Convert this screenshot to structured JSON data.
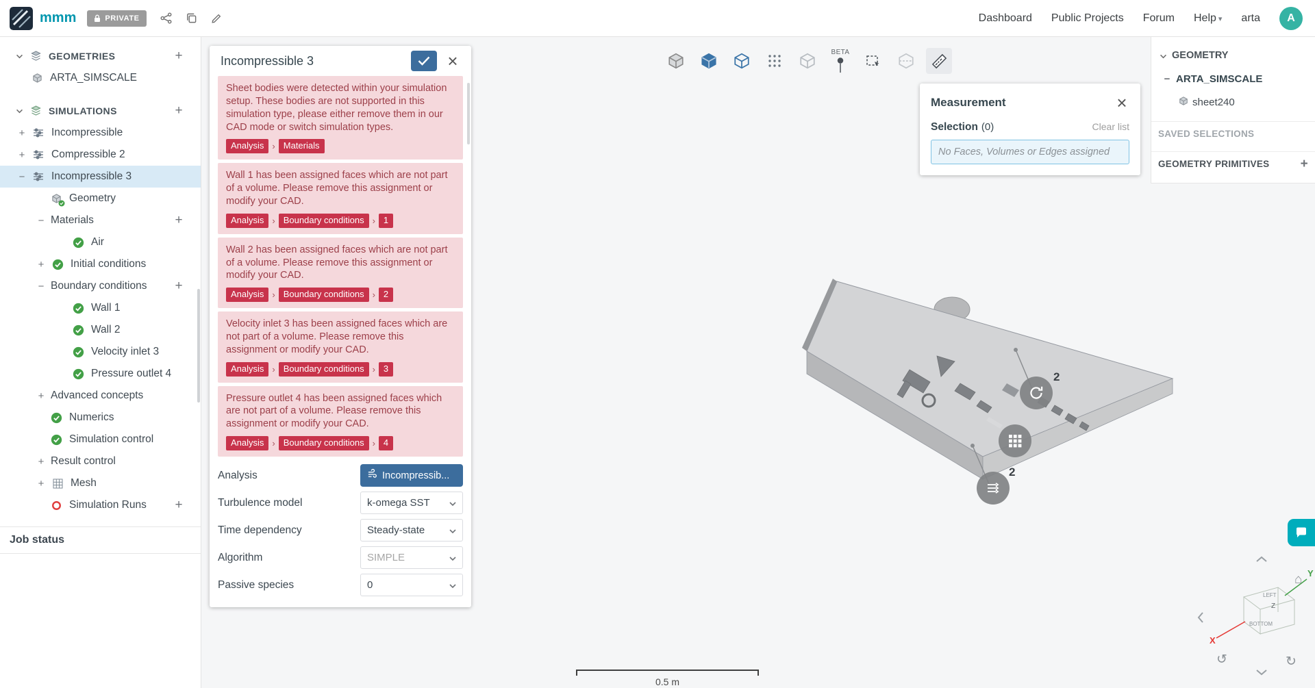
{
  "topbar": {
    "project_name": "mmm",
    "privacy_badge": "PRIVATE",
    "nav_links": [
      "Dashboard",
      "Public Projects",
      "Forum"
    ],
    "help_label": "Help",
    "username": "arta",
    "avatar_initial": "A"
  },
  "toolbar": {
    "beta_label": "BETA"
  },
  "sidebar": {
    "tree": [
      {
        "label": "GEOMETRIES",
        "level": 0,
        "exp": "chev",
        "icon": "stack",
        "add": true,
        "header": true
      },
      {
        "label": "ARTA_SIMSCALE",
        "level": 1,
        "icon": "geom"
      },
      {
        "label": "SIMULATIONS",
        "level": 0,
        "exp": "chev",
        "icon": "sims",
        "add": true,
        "header": true,
        "gap": true
      },
      {
        "label": "Incompressible",
        "level": 1,
        "exp": "plus",
        "icon": "sim"
      },
      {
        "label": "Compressible 2",
        "level": 1,
        "exp": "plus",
        "icon": "sim"
      },
      {
        "label": "Incompressible 3",
        "level": 1,
        "exp": "minus",
        "icon": "sim",
        "selected": true
      },
      {
        "label": "Geometry",
        "level": 2,
        "icon": "geom-check"
      },
      {
        "label": "Materials",
        "level": 2,
        "exp": "minus",
        "add": true
      },
      {
        "label": "Air",
        "level": 3,
        "icon": "check"
      },
      {
        "label": "Initial conditions",
        "level": 2,
        "exp": "plus",
        "icon": "check"
      },
      {
        "label": "Boundary conditions",
        "level": 2,
        "exp": "minus",
        "add": true
      },
      {
        "label": "Wall 1",
        "level": 3,
        "icon": "check"
      },
      {
        "label": "Wall 2",
        "level": 3,
        "icon": "check"
      },
      {
        "label": "Velocity inlet 3",
        "level": 3,
        "icon": "check"
      },
      {
        "label": "Pressure outlet 4",
        "level": 3,
        "icon": "check"
      },
      {
        "label": "Advanced concepts",
        "level": 2,
        "exp": "plus"
      },
      {
        "label": "Numerics",
        "level": 2,
        "icon": "check"
      },
      {
        "label": "Simulation control",
        "level": 2,
        "icon": "check"
      },
      {
        "label": "Result control",
        "level": 2,
        "exp": "plus"
      },
      {
        "label": "Mesh",
        "level": 2,
        "exp": "plus",
        "icon": "mesh"
      },
      {
        "label": "Simulation Runs",
        "level": 2,
        "icon": "record",
        "add": true
      }
    ],
    "job_status_label": "Job status"
  },
  "panel": {
    "title": "Incompressible 3",
    "errors": [
      {
        "text": "Sheet bodies were detected within your simulation setup. These bodies are not supported in this simulation type, please either remove them in our CAD mode or switch simulation types.",
        "badges": [
          "Analysis",
          "Materials"
        ]
      },
      {
        "text": "Wall 1 has been assigned faces which are not part of a volume. Please remove this assignment or modify your CAD.",
        "badges": [
          "Analysis",
          "Boundary conditions",
          "1"
        ]
      },
      {
        "text": "Wall 2 has been assigned faces which are not part of a volume. Please remove this assignment or modify your CAD.",
        "badges": [
          "Analysis",
          "Boundary conditions",
          "2"
        ]
      },
      {
        "text": "Velocity inlet 3 has been assigned faces which are not part of a volume. Please remove this assignment or modify your CAD.",
        "badges": [
          "Analysis",
          "Boundary conditions",
          "3"
        ]
      },
      {
        "text": "Pressure outlet 4 has been assigned faces which are not part of a volume. Please remove this assignment or modify your CAD.",
        "badges": [
          "Analysis",
          "Boundary conditions",
          "4"
        ]
      }
    ],
    "fields": [
      {
        "label": "Analysis",
        "value": "Incompressib...",
        "type": "button"
      },
      {
        "label": "Turbulence model",
        "value": "k-omega SST",
        "type": "select"
      },
      {
        "label": "Time dependency",
        "value": "Steady-state",
        "type": "select"
      },
      {
        "label": "Algorithm",
        "value": "SIMPLE",
        "type": "select-disabled"
      },
      {
        "label": "Passive species",
        "value": "0",
        "type": "select"
      }
    ]
  },
  "measurement": {
    "title": "Measurement",
    "selection_label": "Selection",
    "selection_count": "(0)",
    "clear_label": "Clear list",
    "placeholder": "No Faces, Volumes or Edges assigned"
  },
  "right_panel": {
    "geometry_header": "GEOMETRY",
    "geometry_name": "ARTA_SIMSCALE",
    "sheet_name": "sheet240",
    "saved_selections": "SAVED SELECTIONS",
    "geometry_primitives": "GEOMETRY PRIMITIVES"
  },
  "viewport": {
    "scale_label": "0.5 m",
    "badge_counts": {
      "top": "2",
      "bottom": "2"
    },
    "axes": {
      "x": "X",
      "y": "Y",
      "z": "Z"
    },
    "cube_labels": [
      "LEFT",
      "BOTTOM"
    ]
  },
  "colors": {
    "primary_blue": "#3c6d9d",
    "brand_teal": "#0096ae",
    "error_bg": "#f5d8dc",
    "error_text": "#9c3f49",
    "error_badge": "#c8334b",
    "selected_row": "#d8eaf6",
    "chat_teal": "#00adbc"
  }
}
